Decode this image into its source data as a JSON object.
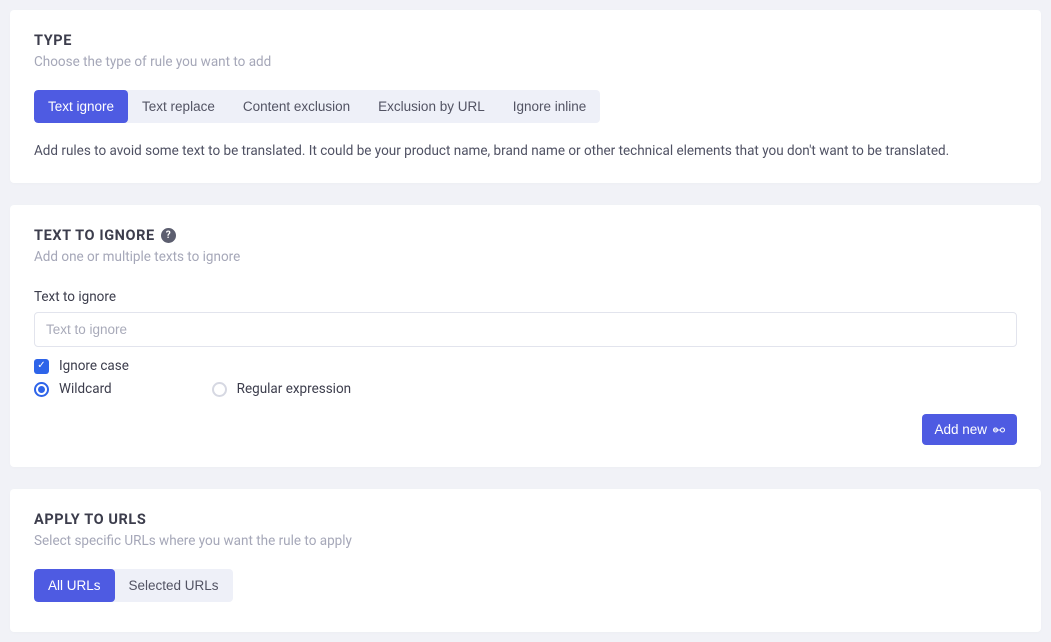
{
  "type_section": {
    "heading": "TYPE",
    "subtext": "Choose the type of rule you want to add",
    "tabs": [
      {
        "label": "Text ignore",
        "active": true
      },
      {
        "label": "Text replace",
        "active": false
      },
      {
        "label": "Content exclusion",
        "active": false
      },
      {
        "label": "Exclusion by URL",
        "active": false
      },
      {
        "label": "Ignore inline",
        "active": false
      }
    ],
    "description": "Add rules to avoid some text to be translated. It could be your product name, brand name or other technical elements that you don't want to be translated."
  },
  "ignore_section": {
    "heading": "TEXT TO IGNORE",
    "subtext": "Add one or multiple texts to ignore",
    "field_label": "Text to ignore",
    "placeholder": "Text to ignore",
    "value": "",
    "ignore_case": {
      "label": "Ignore case",
      "checked": true
    },
    "pattern_radio": {
      "wildcard_label": "Wildcard",
      "regex_label": "Regular expression",
      "selected": "wildcard"
    },
    "add_button": "Add new"
  },
  "urls_section": {
    "heading": "APPLY TO URLS",
    "subtext": "Select specific URLs where you want the rule to apply",
    "tabs": [
      {
        "label": "All URLs",
        "active": true
      },
      {
        "label": "Selected URLs",
        "active": false
      }
    ]
  }
}
